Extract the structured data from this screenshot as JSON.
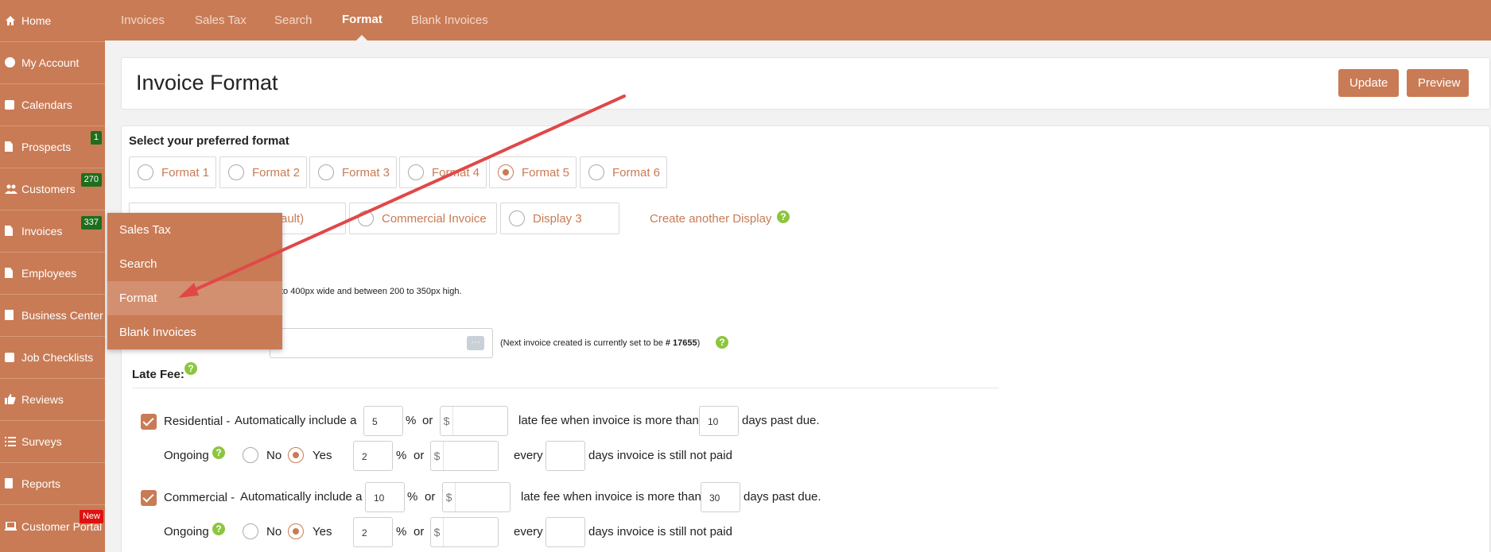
{
  "sidebar": {
    "items": [
      {
        "label": "Home",
        "icon": "home-icon"
      },
      {
        "label": "My Account",
        "icon": "user-circle-icon"
      },
      {
        "label": "Calendars",
        "icon": "calendar-icon"
      },
      {
        "label": "Prospects",
        "icon": "document-icon",
        "badge": "1"
      },
      {
        "label": "Customers",
        "icon": "users-icon",
        "badge": "270"
      },
      {
        "label": "Invoices",
        "icon": "document-icon",
        "badge": "337"
      },
      {
        "label": "Employees",
        "icon": "document-icon"
      },
      {
        "label": "Business Center",
        "icon": "building-icon"
      },
      {
        "label": "Job Checklists",
        "icon": "checklist-icon"
      },
      {
        "label": "Reviews",
        "icon": "thumbs-up-icon"
      },
      {
        "label": "Surveys",
        "icon": "list-icon"
      },
      {
        "label": "Reports",
        "icon": "clipboard-icon"
      },
      {
        "label": "Customer Portal",
        "icon": "laptop-icon",
        "badge": "New"
      }
    ]
  },
  "topnav": {
    "tabs": [
      {
        "label": "Invoices"
      },
      {
        "label": "Sales Tax"
      },
      {
        "label": "Search"
      },
      {
        "label": "Format",
        "active": true
      },
      {
        "label": "Blank Invoices"
      }
    ]
  },
  "header": {
    "title": "Invoice Format",
    "update_label": "Update",
    "preview_label": "Preview"
  },
  "format": {
    "heading": "Select your preferred format",
    "options": [
      "Format 1",
      "Format 2",
      "Format 3",
      "Format 4",
      "Format 5",
      "Format 6"
    ],
    "selected": "Format 5"
  },
  "display": {
    "options": [
      "ault)",
      "Commercial Invoice",
      "Display 3"
    ],
    "create_link": "Create another Display"
  },
  "logo_note": "to 400px wide and between 200 to 350px high.",
  "invoice_number": {
    "note_prefix": "(Next invoice created is currently set to be ",
    "note_value": "# 17655",
    "note_suffix": ")"
  },
  "late_fee": {
    "heading": "Late Fee:",
    "residential": {
      "label": "Residential -",
      "auto_text": "Automatically include a",
      "percent": "5",
      "dollar": "",
      "mid_text": "late fee when invoice is more than",
      "days": "10",
      "end_text": "days past due.",
      "ongoing_label": "Ongoing",
      "no_label": "No",
      "yes_label": "Yes",
      "ongoing_percent": "2",
      "ongoing_dollar": "",
      "every_text": "every",
      "ongoing_days": "",
      "ongoing_end": "days invoice is still not paid"
    },
    "commercial": {
      "label": "Commercial -",
      "auto_text": "Automatically include a",
      "percent": "10",
      "dollar": "",
      "mid_text": "late fee when invoice is more than",
      "days": "30",
      "end_text": "days past due.",
      "ongoing_label": "Ongoing",
      "no_label": "No",
      "yes_label": "Yes",
      "ongoing_percent": "2",
      "ongoing_dollar": "",
      "every_text": "every",
      "ongoing_days": "",
      "ongoing_end": "days invoice is still not paid"
    },
    "percent_sign": "%",
    "or_text": "or",
    "dollar_sign": "$"
  },
  "dropdown": {
    "items": [
      "Sales Tax",
      "Search",
      "Format",
      "Blank Invoices"
    ],
    "highlighted": "Format"
  },
  "colors": {
    "brand": "#c97b55",
    "help": "#8cc63f",
    "badge": "#1e6e1e",
    "new_badge": "#e01010",
    "arrow": "#e04848"
  }
}
